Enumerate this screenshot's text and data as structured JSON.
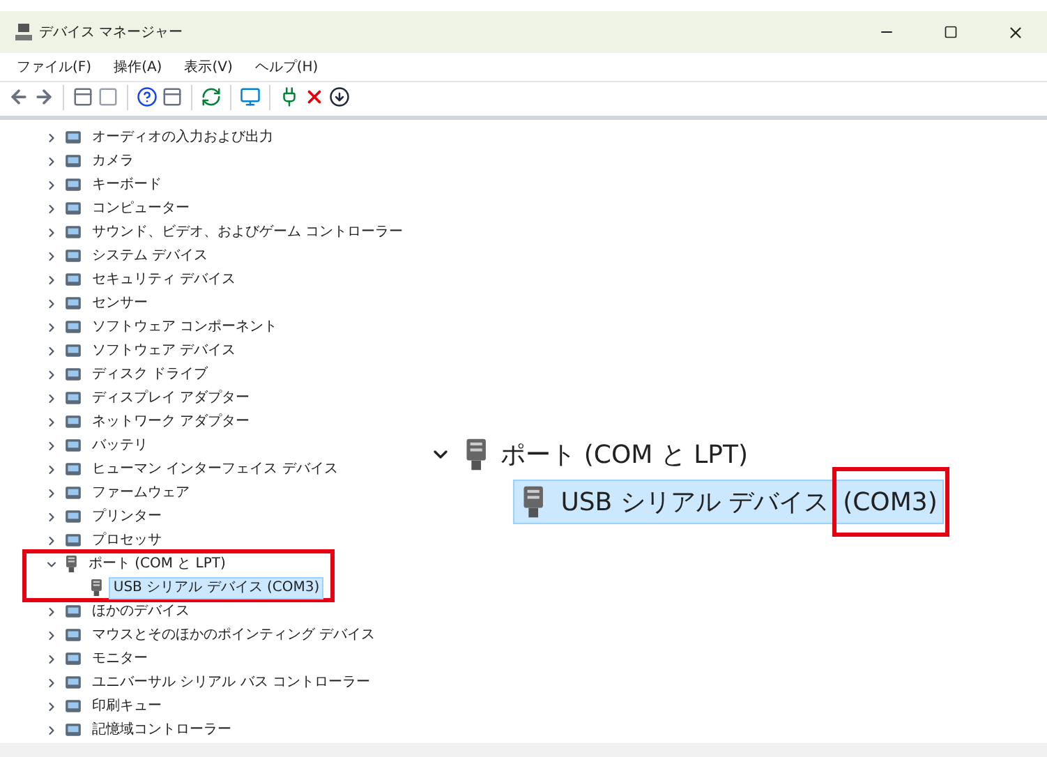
{
  "window": {
    "title": "デバイス マネージャー"
  },
  "menu": [
    "ファイル(F)",
    "操作(A)",
    "表示(V)",
    "ヘルプ(H)"
  ],
  "toolbar": [
    {
      "kind": "back"
    },
    {
      "kind": "forward"
    },
    {
      "kind": "sep"
    },
    {
      "kind": "panel"
    },
    {
      "kind": "blank"
    },
    {
      "kind": "sep"
    },
    {
      "kind": "help"
    },
    {
      "kind": "panel"
    },
    {
      "kind": "sep"
    },
    {
      "kind": "scan"
    },
    {
      "kind": "sep"
    },
    {
      "kind": "monitor"
    },
    {
      "kind": "sep"
    },
    {
      "kind": "enable"
    },
    {
      "kind": "remove"
    },
    {
      "kind": "download"
    }
  ],
  "tree": [
    {
      "label": "オーディオの入力および出力",
      "expanded": false,
      "selected": false
    },
    {
      "label": "カメラ",
      "expanded": false,
      "selected": false
    },
    {
      "label": "キーボード",
      "expanded": false,
      "selected": false
    },
    {
      "label": "コンピューター",
      "expanded": false,
      "selected": false
    },
    {
      "label": "サウンド、ビデオ、およびゲーム コントローラー",
      "expanded": false,
      "selected": false
    },
    {
      "label": "システム デバイス",
      "expanded": false,
      "selected": false
    },
    {
      "label": "セキュリティ デバイス",
      "expanded": false,
      "selected": false
    },
    {
      "label": "センサー",
      "expanded": false,
      "selected": false
    },
    {
      "label": "ソフトウェア コンポーネント",
      "expanded": false,
      "selected": false
    },
    {
      "label": "ソフトウェア デバイス",
      "expanded": false,
      "selected": false
    },
    {
      "label": "ディスク ドライブ",
      "expanded": false,
      "selected": false
    },
    {
      "label": "ディスプレイ アダプター",
      "expanded": false,
      "selected": false
    },
    {
      "label": "ネットワーク アダプター",
      "expanded": false,
      "selected": false
    },
    {
      "label": "バッテリ",
      "expanded": false,
      "selected": false
    },
    {
      "label": "ヒューマン インターフェイス デバイス",
      "expanded": false,
      "selected": false
    },
    {
      "label": "ファームウェア",
      "expanded": false,
      "selected": false
    },
    {
      "label": "プリンター",
      "expanded": false,
      "selected": false
    },
    {
      "label": "プロセッサ",
      "expanded": false,
      "selected": false
    },
    {
      "label": "ポート (COM と LPT)",
      "expanded": true,
      "selected": false,
      "highlighted": true,
      "children": [
        {
          "label": "USB シリアル デバイス (COM3)",
          "selected": true
        }
      ]
    },
    {
      "label": "ほかのデバイス",
      "expanded": false,
      "selected": false
    },
    {
      "label": "マウスとそのほかのポインティング デバイス",
      "expanded": false,
      "selected": false
    },
    {
      "label": "モニター",
      "expanded": false,
      "selected": false
    },
    {
      "label": "ユニバーサル シリアル バス コントローラー",
      "expanded": false,
      "selected": false
    },
    {
      "label": "印刷キュー",
      "expanded": false,
      "selected": false
    },
    {
      "label": "記憶域コントローラー",
      "expanded": false,
      "selected": false
    }
  ],
  "callout": {
    "category": "ポート (COM と LPT)",
    "expanded": true,
    "device_name": "USB シリアル デバイス",
    "device_port": "(COM3)",
    "selected": true
  }
}
